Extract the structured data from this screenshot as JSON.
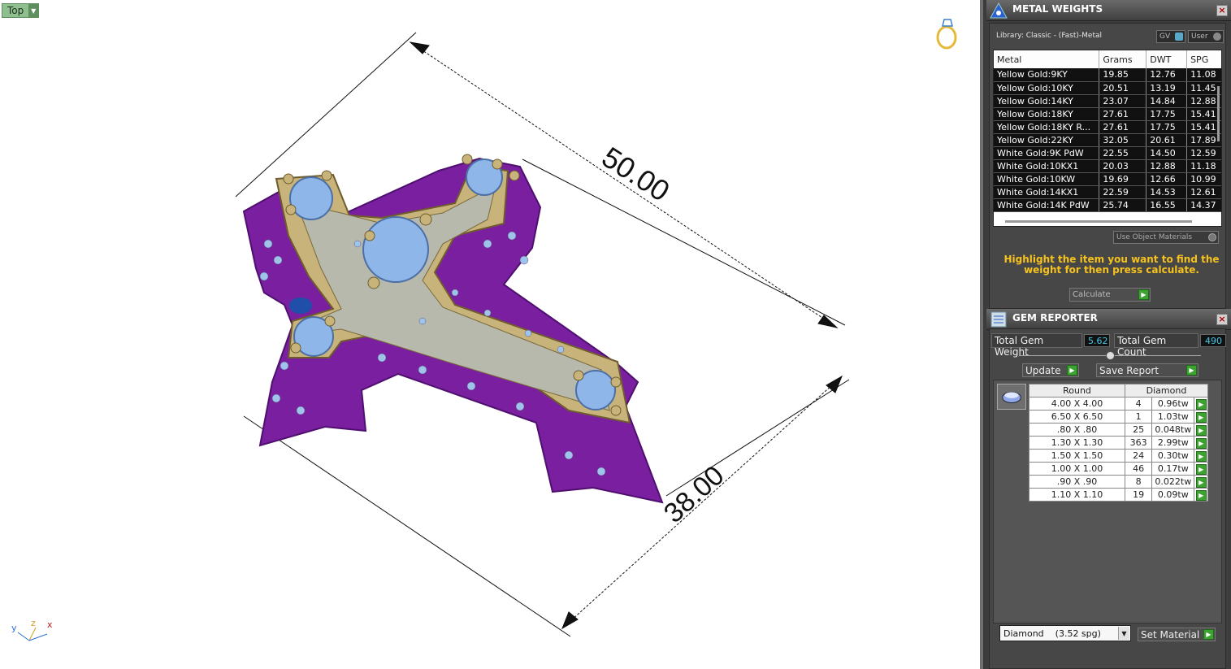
{
  "viewport": {
    "view_label": "Top",
    "dimension_length": "50.00",
    "dimension_width": "38.00",
    "axis": {
      "x": "x",
      "y": "y",
      "z": "z"
    },
    "colors": {
      "metal_gold": "#c8b47a",
      "metal_purple": "#7a1fa0",
      "gem_blue": "#8fb6e8"
    }
  },
  "metal_weights": {
    "title": "METAL WEIGHTS",
    "library": "Library: Classic - (Fast)-Metal",
    "toggle_gv": "GV",
    "toggle_user": "User",
    "columns": [
      "Metal",
      "Grams",
      "DWT",
      "SPG"
    ],
    "rows": [
      [
        "Yellow Gold:9KY",
        "19.85",
        "12.76",
        "11.08"
      ],
      [
        "Yellow Gold:10KY",
        "20.51",
        "13.19",
        "11.45"
      ],
      [
        "Yellow Gold:14KY",
        "23.07",
        "14.84",
        "12.88"
      ],
      [
        "Yellow Gold:18KY",
        "27.61",
        "17.75",
        "15.41"
      ],
      [
        "Yellow Gold:18KY R...",
        "27.61",
        "17.75",
        "15.41"
      ],
      [
        "Yellow Gold:22KY",
        "32.05",
        "20.61",
        "17.89"
      ],
      [
        "White Gold:9K PdW",
        "22.55",
        "14.50",
        "12.59"
      ],
      [
        "White Gold:10KX1",
        "20.03",
        "12.88",
        "11.18"
      ],
      [
        "White Gold:10KW",
        "19.69",
        "12.66",
        "10.99"
      ],
      [
        "White Gold:14KX1",
        "22.59",
        "14.53",
        "12.61"
      ],
      [
        "White Gold:14K PdW",
        "25.74",
        "16.55",
        "14.37"
      ]
    ],
    "use_object_materials": "Use Object Materials",
    "hint": "Highlight the item you want to find the weight for then press calculate.",
    "calculate_label": "Calculate"
  },
  "gem_reporter": {
    "title": "GEM REPORTER",
    "total_weight_label": "Total Gem Weight",
    "total_weight_value": "5.62",
    "total_count_label": "Total Gem Count",
    "total_count_value": "490",
    "update_label": "Update",
    "save_report_label": "Save Report",
    "columns": [
      "Round",
      "Diamond"
    ],
    "rows": [
      [
        "4.00 X 4.00",
        "4",
        "0.96tw"
      ],
      [
        "6.50 X 6.50",
        "1",
        "1.03tw"
      ],
      [
        ".80 X .80",
        "25",
        "0.048tw"
      ],
      [
        "1.30 X 1.30",
        "363",
        "2.99tw"
      ],
      [
        "1.50 X 1.50",
        "24",
        "0.30tw"
      ],
      [
        "1.00 X 1.00",
        "46",
        "0.17tw"
      ],
      [
        ".90 X .90",
        "8",
        "0.022tw"
      ],
      [
        "1.10 X 1.10",
        "19",
        "0.09tw"
      ]
    ],
    "material_select": "Diamond    (3.52 spg)",
    "set_material_label": "Set Material"
  }
}
